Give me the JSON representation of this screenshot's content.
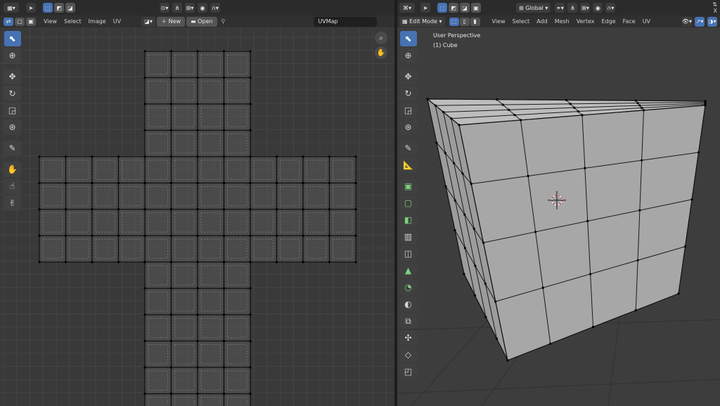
{
  "uv_editor": {
    "header_menus": [
      "View",
      "Select",
      "Image",
      "UV"
    ],
    "new_label": "New",
    "open_label": "Open",
    "uvmap_name": "UVMap",
    "tools": [
      "select-box-icon",
      "cursor-icon",
      "move-icon",
      "rotate-icon",
      "scale-icon",
      "transform-icon",
      "annotate-icon",
      "grab-icon",
      "relax-icon",
      "pinch-icon"
    ]
  },
  "viewport": {
    "mode_label": "Edit Mode",
    "header_menus": [
      "View",
      "Select",
      "Add",
      "Mesh",
      "Vertex",
      "Edge",
      "Face",
      "UV"
    ],
    "orientation_label": "Global",
    "overlay_title": "User Perspective",
    "overlay_object": "(1) Cube",
    "close_label": "X",
    "tools": [
      "select-box-icon",
      "cursor-icon",
      "move-icon",
      "rotate-icon",
      "scale-icon",
      "transform-icon",
      "annotate-icon",
      "measure-icon",
      "extrude-icon",
      "inset-icon",
      "bevel-icon",
      "loop-cut-icon",
      "knife-icon",
      "poly-build-icon",
      "spin-icon",
      "smooth-icon",
      "edge-slide-icon",
      "shrink-fatten-icon",
      "shear-icon",
      "rip-icon"
    ]
  },
  "colors": {
    "accent": "#4772b3",
    "header": "#2b2b2b",
    "uv_bg": "#393939",
    "viewport_bg": "#3d3d3d",
    "mesh_face": "#a7a7a7",
    "x_axis": "#c8484a"
  }
}
